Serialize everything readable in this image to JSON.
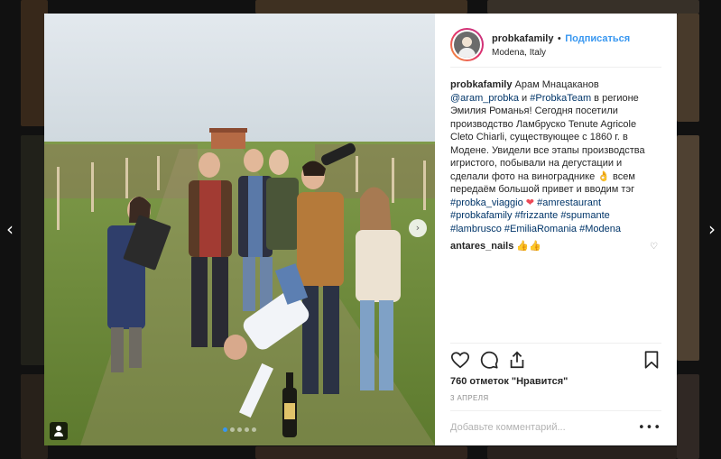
{
  "navigation": {
    "prev_glyph": "‹",
    "next_glyph": "›"
  },
  "post": {
    "username": "probkafamily",
    "separator": "•",
    "follow_label": "Подписаться",
    "location": "Modena, Italy",
    "caption": {
      "username": "probkafamily",
      "text_1": " Арам Мнацаканов ",
      "mention": "@aram_probka",
      "text_2": " и ",
      "tag_team": "#ProbkaTeam",
      "text_3": " в регионе Эмилия Романья! Сегодня посетили производство Ламбруско Tenute Agricole Cleto Chiarli, существующее с 1860 г. в Модене. Увидели все этапы производства игристого, побывали на дегустации и сделали фото на винограднике 👌 всем передаём большой привет и вводим тэг ",
      "tag_viaggio": "#probka_viaggio",
      "heart": "❤",
      "tag_amrestaurant": "#amrestaurant",
      "tag_probkafamily": "#probkafamily",
      "tag_frizzante": "#frizzante",
      "tag_spumante": "#spumante",
      "tag_lambrusco": "#lambrusco",
      "tag_emiliaromania": "#EmiliaRomania",
      "tag_modena": "#Modena"
    },
    "comment": {
      "username": "antares_nails",
      "text": " 👍👍"
    },
    "likes_text": "760 отметок \"Нравится\"",
    "date": "3 АПРЕЛЯ",
    "comment_placeholder": "Добавьте комментарий...",
    "more_glyph": "•••",
    "photo_next_glyph": "›",
    "carousel": {
      "count": 5,
      "active_index": 0
    }
  },
  "colors": {
    "link": "#003569",
    "follow": "#3897f0",
    "heart": "#ed4956",
    "muted": "#8e8e8e",
    "divider": "#efefef"
  },
  "icons": [
    "heart-icon",
    "comment-icon",
    "share-icon",
    "bookmark-icon",
    "tag-people-icon",
    "avatar"
  ]
}
